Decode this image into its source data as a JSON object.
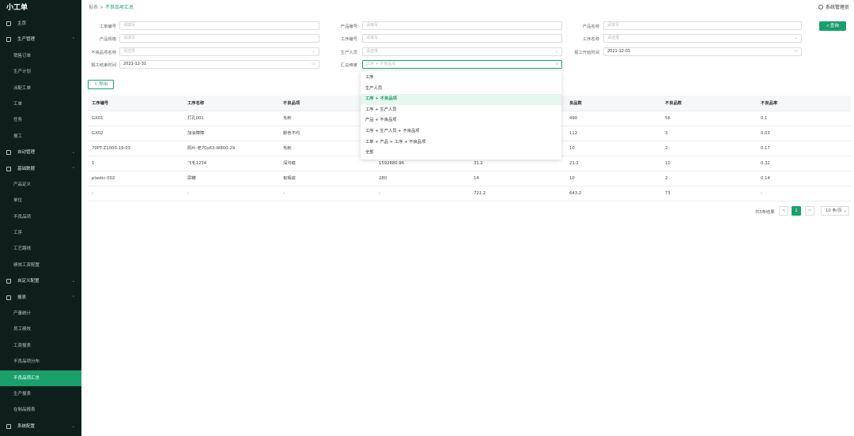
{
  "app": {
    "title": "小工单"
  },
  "sidebar": {
    "items": [
      {
        "label": "主页",
        "level": "top",
        "icon": "home-icon",
        "chevron": ""
      },
      {
        "label": "生产管理",
        "level": "top",
        "icon": "production-icon",
        "chevron": "⌃"
      },
      {
        "label": "销售订单",
        "level": "sub"
      },
      {
        "label": "生产计划",
        "level": "sub"
      },
      {
        "label": "派配工单",
        "level": "sub"
      },
      {
        "label": "工单",
        "level": "sub"
      },
      {
        "label": "任务",
        "level": "sub"
      },
      {
        "label": "报工",
        "level": "sub"
      },
      {
        "label": "自动管理",
        "level": "top",
        "icon": "gear-icon",
        "chevron": "⌄"
      },
      {
        "label": "基础数据",
        "level": "top",
        "icon": "database-icon",
        "chevron": "⌃"
      },
      {
        "label": "产品定义",
        "level": "sub"
      },
      {
        "label": "单位",
        "level": "sub"
      },
      {
        "label": "不良品项",
        "level": "sub"
      },
      {
        "label": "工序",
        "level": "sub"
      },
      {
        "label": "工艺路线",
        "level": "sub"
      },
      {
        "label": "绩效工资配置",
        "level": "sub"
      },
      {
        "label": "自定义配置",
        "level": "top",
        "icon": "config-icon",
        "chevron": "⌄"
      },
      {
        "label": "报表",
        "level": "top",
        "icon": "report-icon",
        "chevron": "⌃"
      },
      {
        "label": "产量统计",
        "level": "sub"
      },
      {
        "label": "员工绩效",
        "level": "sub"
      },
      {
        "label": "工资报表",
        "level": "sub"
      },
      {
        "label": "不良品项分布",
        "level": "sub"
      },
      {
        "label": "不良品项汇总",
        "level": "sub",
        "active": true
      },
      {
        "label": "生产报表",
        "level": "sub"
      },
      {
        "label": "在制品报表",
        "level": "sub"
      },
      {
        "label": "系统配置",
        "level": "top",
        "icon": "settings-icon",
        "chevron": "⌄"
      }
    ]
  },
  "header": {
    "crumb_parent": "报表",
    "crumb_sep": ">",
    "crumb_current": "不良品项汇总",
    "user": "系统管理员"
  },
  "form": {
    "fields": [
      {
        "label": "工单编号",
        "placeholder": "请填写"
      },
      {
        "label": "产品编号",
        "placeholder": "请填写"
      },
      {
        "label": "产品名称",
        "placeholder": "请填写"
      },
      {
        "label": "产品规格",
        "placeholder": "请填写"
      },
      {
        "label": "工序编号",
        "placeholder": "请填写"
      },
      {
        "label": "工序名称",
        "placeholder": "请选择",
        "suffix": "⌄"
      },
      {
        "label": "不良品项名称",
        "placeholder": "请选择",
        "suffix": "⌄"
      },
      {
        "label": "生产人员",
        "placeholder": "请选择",
        "suffix": "⌄"
      },
      {
        "label": "报工开始时间",
        "value": "2021-12-01",
        "suffix": "▭"
      },
      {
        "label": "报工结束时间",
        "value": "2021-12-31",
        "suffix": "▭"
      },
      {
        "label": "汇总维度",
        "placeholder": "工序 + 不良品项",
        "suffix": "⌕",
        "focus": true
      }
    ],
    "query_label": "查询",
    "export_label": "导出"
  },
  "dropdown": {
    "options": [
      "工序",
      "生产人员",
      "工序 + 不良品项",
      "工序 + 生产人员",
      "产品 + 不良品项",
      "工序 + 生产人员 + 不良品项",
      "工单 + 产品 + 工序 + 不良品项",
      "全部"
    ],
    "selected_index": 2
  },
  "table": {
    "columns": [
      "工序编号",
      "工序名称",
      "不良品项",
      "",
      "",
      "良品数",
      "不良品数",
      "不良品率"
    ],
    "rows": [
      [
        "GX01",
        "打孔001",
        "毛刺",
        "",
        "",
        "490",
        "56",
        "0.1"
      ],
      [
        "GX02",
        "加油障障",
        "颜色不均",
        "",
        "",
        "112",
        "3",
        "0.03"
      ],
      [
        "70PT-Z1000-19-03",
        "阳片-老70x63-W800-29",
        "毛刺",
        "",
        "",
        "10",
        "2",
        "0.17"
      ],
      [
        "1",
        "飞毛1234",
        "深沟痕",
        "1592680.96",
        "31.2",
        "21.2",
        "10",
        "0.32"
      ],
      [
        "plastic-002",
        "尿糟",
        "有瑕疵",
        "280",
        "14",
        "10",
        "2",
        "0.14"
      ],
      [
        "-",
        "-",
        "-",
        "-",
        "721.2",
        "643.2",
        "73",
        "-"
      ]
    ]
  },
  "pagination": {
    "total": "共5条结果",
    "prev": "<",
    "page": "1",
    "next": ">",
    "size": "10 条/页 ⌄"
  },
  "colors": {
    "accent": "#1aa06d",
    "sidebar_bg": "#0e1f1b"
  }
}
